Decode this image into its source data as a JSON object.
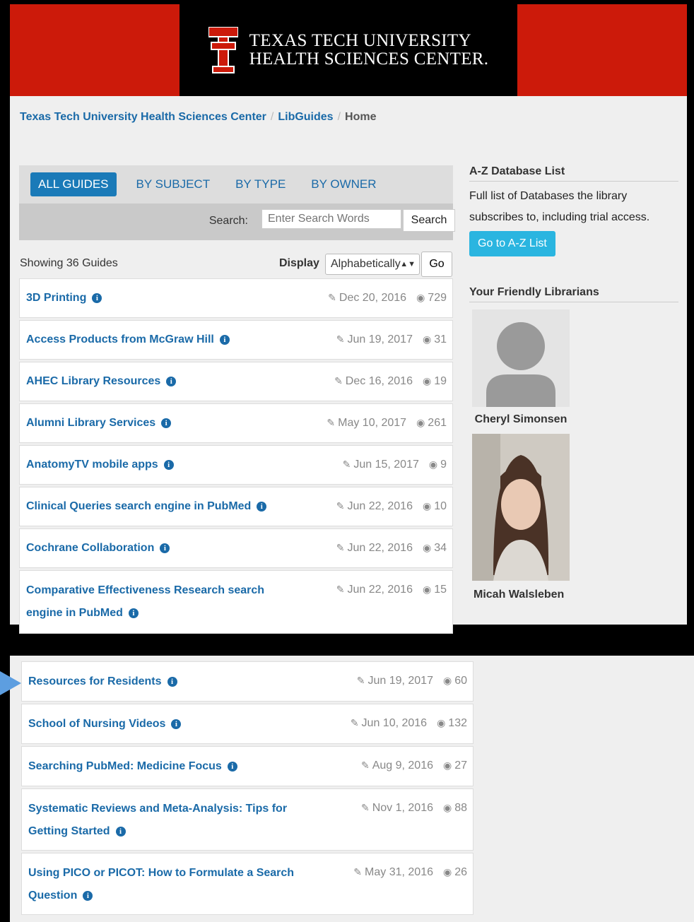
{
  "banner": {
    "line1": "TEXAS TECH UNIVERSITY",
    "line2": "HEALTH SCIENCES CENTER."
  },
  "breadcrumb": {
    "root": "Texas Tech University Health Sciences Center",
    "libguides": "LibGuides",
    "current": "Home",
    "separator": "/"
  },
  "tabs": [
    {
      "label": "ALL GUIDES",
      "active": true
    },
    {
      "label": "BY SUBJECT",
      "active": false
    },
    {
      "label": "BY TYPE",
      "active": false
    },
    {
      "label": "BY OWNER",
      "active": false
    }
  ],
  "search": {
    "label": "Search:",
    "placeholder": "Enter Search Words",
    "button": "Search"
  },
  "listing": {
    "showing": "Showing 36 Guides",
    "display_label": "Display",
    "display_value": "Alphabetically",
    "go": "Go"
  },
  "guides": [
    {
      "title": "3D Printing",
      "date": "Dec 20, 2016",
      "views": "729"
    },
    {
      "title": "Access Products from McGraw Hill",
      "date": "Jun 19, 2017",
      "views": "31"
    },
    {
      "title": "AHEC Library Resources",
      "date": "Dec 16, 2016",
      "views": "19"
    },
    {
      "title": "Alumni Library Services",
      "date": "May 10, 2017",
      "views": "261"
    },
    {
      "title": "AnatomyTV mobile apps",
      "date": "Jun 15, 2017",
      "views": "9"
    },
    {
      "title": "Clinical Queries search engine in PubMed",
      "date": "Jun 22, 2016",
      "views": "10"
    },
    {
      "title": "Cochrane Collaboration",
      "date": "Jun 22, 2016",
      "views": "34"
    },
    {
      "title": "Comparative Effectiveness Research search engine in PubMed",
      "date": "Jun 22, 2016",
      "views": "15"
    }
  ],
  "guides_bottom": [
    {
      "title": "Resources for Residents",
      "date": "Jun 19, 2017",
      "views": "60"
    },
    {
      "title": "School of Nursing Videos",
      "date": "Jun 10, 2016",
      "views": "132"
    },
    {
      "title": "Searching PubMed: Medicine Focus",
      "date": "Aug 9, 2016",
      "views": "27"
    },
    {
      "title": "Systematic Reviews and Meta-Analysis: Tips for Getting Started",
      "date": "Nov 1, 2016",
      "views": "88"
    },
    {
      "title": "Using PICO or PICOT: How to Formulate a Search Question",
      "date": "May 31, 2016",
      "views": "26"
    }
  ],
  "sidebar": {
    "az_heading": "A-Z Database List",
    "az_text": "Full list of Databases the library subscribes to, including trial access.",
    "az_button": "Go to A-Z List",
    "librarians_heading": "Your Friendly Librarians",
    "librarians": [
      {
        "name": "Cheryl Simonsen"
      },
      {
        "name": "Micah Walsleben"
      }
    ]
  },
  "icons": {
    "edit": "edit-icon",
    "views": "eye-icon",
    "info": "info-icon"
  },
  "colors": {
    "brand_red": "#cc1a0a",
    "link_blue": "#1a6aa8",
    "az_button": "#2ab5e0"
  }
}
